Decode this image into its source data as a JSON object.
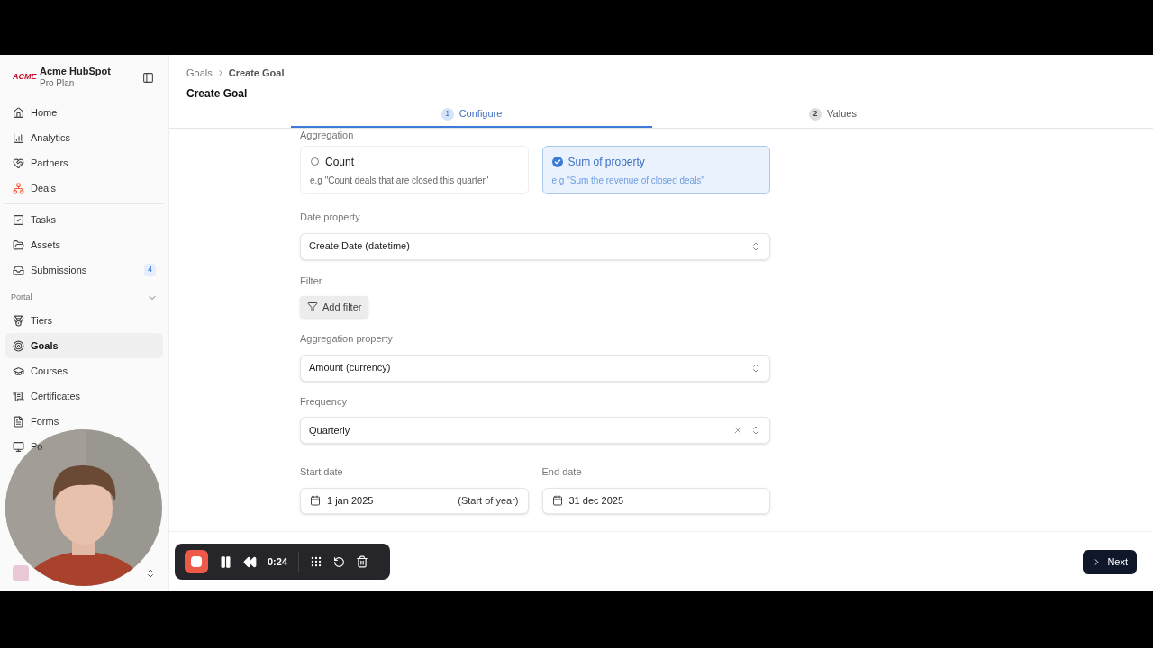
{
  "sidebar": {
    "brand": {
      "logo": "ACME",
      "name": "Acme HubSpot",
      "plan": "Pro Plan"
    },
    "groups": [
      {
        "items": [
          {
            "label": "Home",
            "selected": false
          },
          {
            "label": "Analytics",
            "selected": false
          },
          {
            "label": "Partners",
            "selected": false
          },
          {
            "label": "Deals",
            "selected": false
          }
        ]
      },
      {
        "items": [
          {
            "label": "Tasks",
            "selected": false
          },
          {
            "label": "Assets",
            "selected": false
          },
          {
            "label": "Submissions",
            "selected": false,
            "badge": "4"
          }
        ]
      },
      {
        "title": "Portal",
        "expanded": true,
        "items": [
          {
            "label": "Tiers",
            "selected": false
          },
          {
            "label": "Goals",
            "selected": true
          },
          {
            "label": "Courses",
            "selected": false
          },
          {
            "label": "Certificates",
            "selected": false
          },
          {
            "label": "Forms",
            "selected": false
          },
          {
            "label": "Po",
            "selected": false
          }
        ]
      }
    ]
  },
  "breadcrumb": [
    "Goals",
    "Create Goal"
  ],
  "title": "Create Goal",
  "steps": [
    {
      "number": "1",
      "label": "Configure",
      "selected": true
    },
    {
      "number": "2",
      "label": "Values",
      "selected": false
    }
  ],
  "form": {
    "aggregation": {
      "label": "Aggregation",
      "options": [
        {
          "title": "Count",
          "example": "e.g \"Count deals that are closed this quarter\"",
          "selected": false
        },
        {
          "title": "Sum of property",
          "example": "e.g \"Sum the revenue of closed deals\"",
          "selected": true
        }
      ]
    },
    "date_property": {
      "label": "Date property",
      "value": "Create Date (datetime)"
    },
    "filter": {
      "label": "Filter",
      "button": "Add filter"
    },
    "aggregation_property": {
      "label": "Aggregation property",
      "value": "Amount (currency)"
    },
    "frequency": {
      "label": "Frequency",
      "value": "Quarterly",
      "clearable": true
    },
    "start_date": {
      "label": "Start date",
      "value": "1 jan 2025",
      "hint": "(Start of year)"
    },
    "end_date": {
      "label": "End date",
      "value": "31 dec 2025"
    }
  },
  "next_button": "Next",
  "recorder": {
    "time": "0:24"
  }
}
